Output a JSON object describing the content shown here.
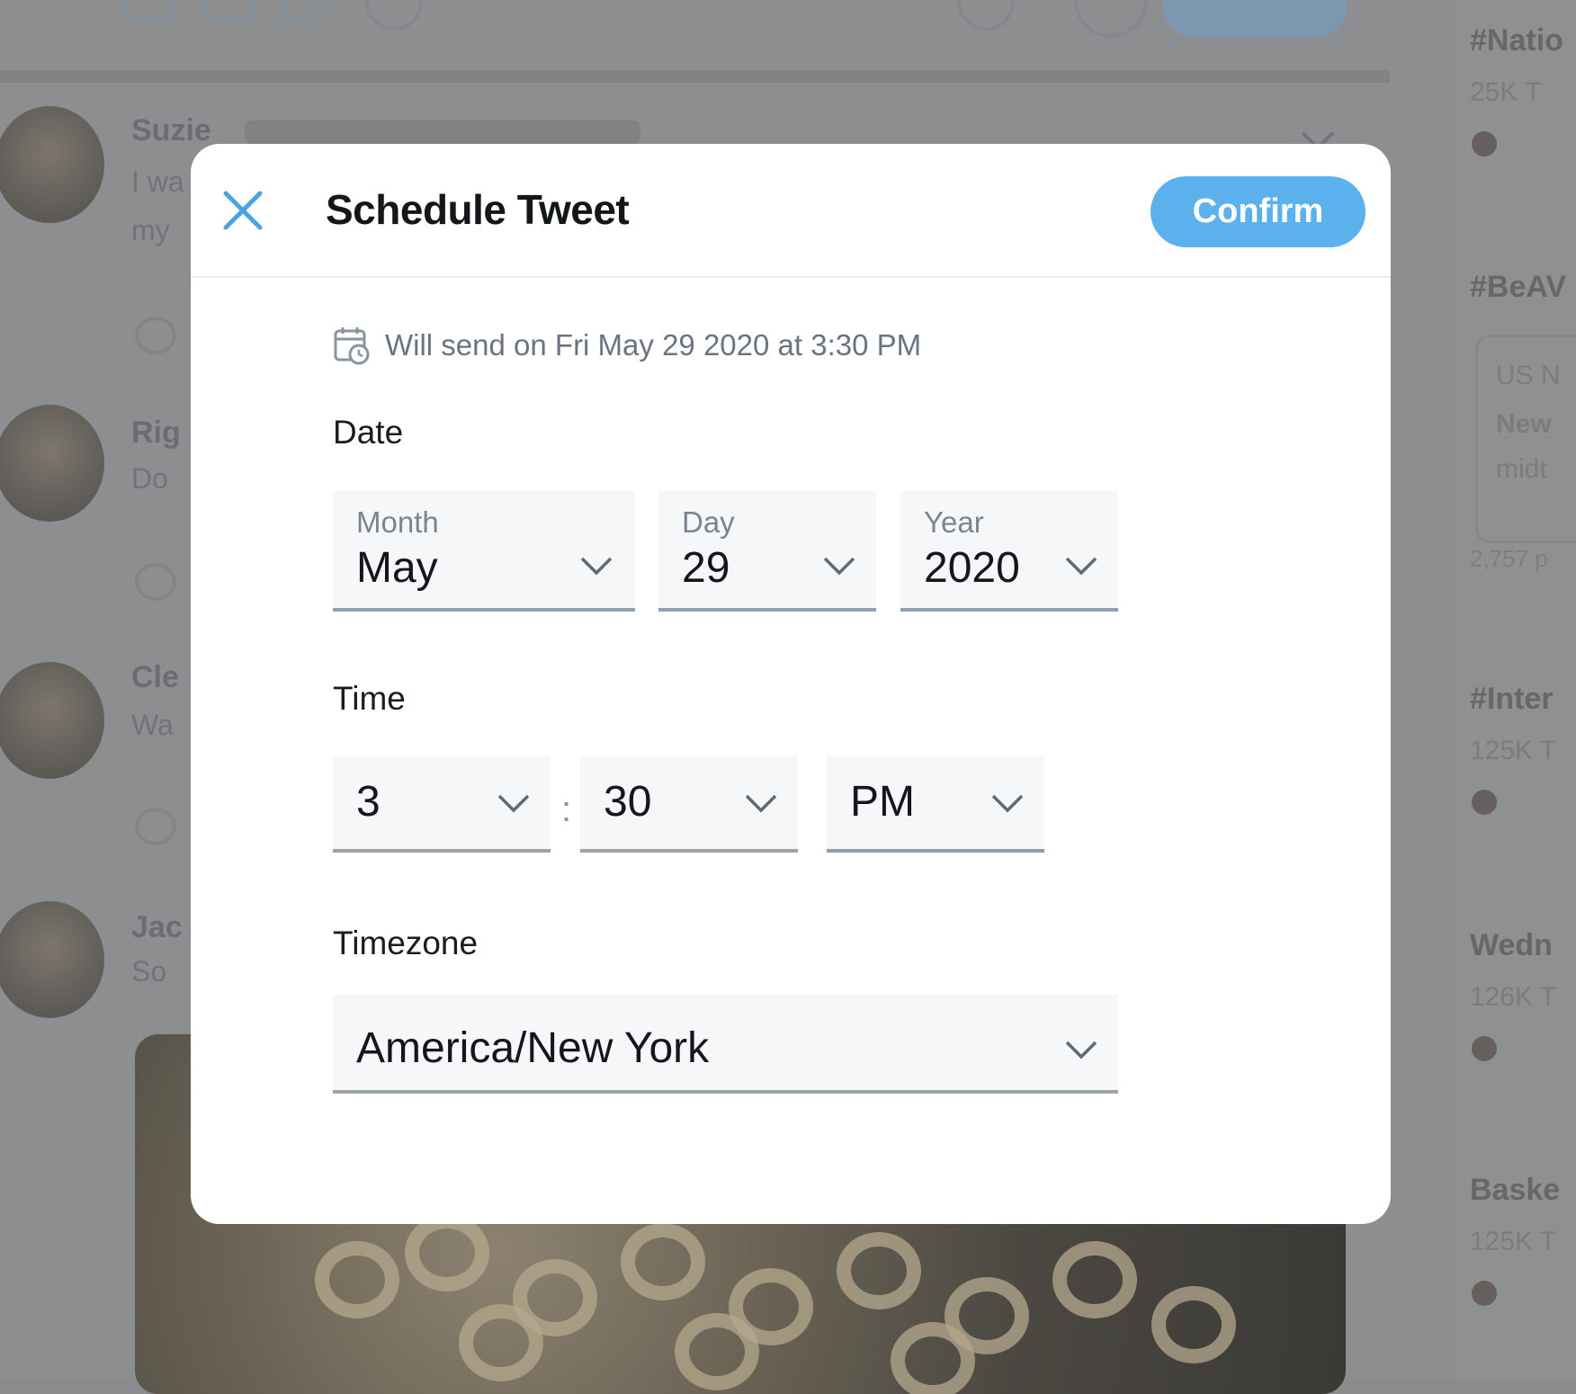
{
  "background": {
    "posts": [
      {
        "name": "Suzie",
        "text1": "I wa",
        "text2": "my"
      },
      {
        "name": "Rig",
        "text1": "Do"
      },
      {
        "name": "Cle",
        "text1": "Wa"
      },
      {
        "name": "Jac",
        "text1": "So"
      }
    ],
    "trends": [
      {
        "title": "#Natio",
        "sub": "25K T"
      },
      {
        "title": "#BeAV",
        "sub": ""
      },
      {
        "title": "#Inter",
        "sub": "125K T"
      },
      {
        "title": "Wedn",
        "sub": "126K T"
      },
      {
        "title": "Baske",
        "sub": "125K T"
      }
    ],
    "news": {
      "line1": "US N",
      "line2": "New",
      "line3": "midt",
      "count": "2,757 p"
    }
  },
  "modal": {
    "title": "Schedule Tweet",
    "confirm_label": "Confirm",
    "send_info": "Will send on Fri May 29 2020 at 3:30 PM",
    "date_label": "Date",
    "time_label": "Time",
    "timezone_label": "Timezone",
    "month": {
      "label": "Month",
      "value": "May"
    },
    "day": {
      "label": "Day",
      "value": "29"
    },
    "year": {
      "label": "Year",
      "value": "2020"
    },
    "hour": {
      "value": "3"
    },
    "time_separator": ":",
    "minute": {
      "value": "30"
    },
    "ampm": {
      "value": "PM"
    },
    "timezone": {
      "value": "America/New York"
    }
  },
  "colors": {
    "accent": "#5bb1ec",
    "close_icon": "#4aa3e6",
    "title": "#14171a"
  },
  "icons": [
    "close-icon",
    "calendar-clock-icon",
    "chevron-down-icon"
  ]
}
